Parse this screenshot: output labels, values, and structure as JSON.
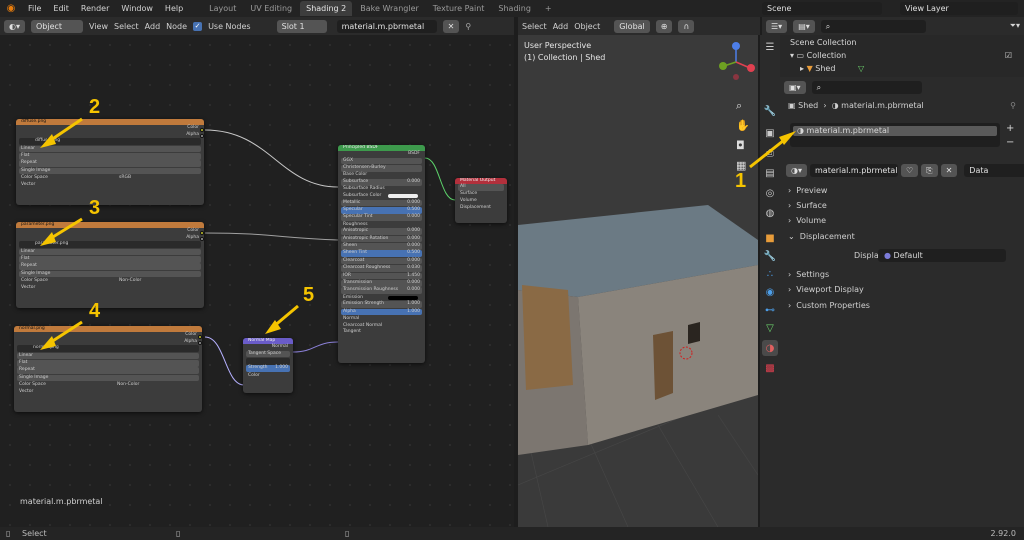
{
  "menu": [
    "File",
    "Edit",
    "Render",
    "Window",
    "Help"
  ],
  "workspaces": [
    "Layout",
    "UV Editing",
    "Shading 2",
    "Bake Wrangler",
    "Texture Paint",
    "Shading"
  ],
  "active_ws": "Shading 2",
  "scene": "Scene",
  "view_layer": "View Layer",
  "node_header": {
    "mode": "Object",
    "menus": [
      "View",
      "Select",
      "Add",
      "Node"
    ],
    "use_nodes": "Use Nodes",
    "slot": "Slot 1",
    "material": "material.m.pbrmetal"
  },
  "vp_header": {
    "menus": [
      "Select",
      "Add",
      "Object"
    ],
    "orient": "Global"
  },
  "viewport": {
    "title": "User Perspective",
    "subtitle": "(1) Collection | Shed"
  },
  "outliner": {
    "root": "Scene Collection",
    "collection": "Collection",
    "object": "Shed"
  },
  "props": {
    "crumb_obj": "Shed",
    "crumb_mat": "material.m.pbrmetal",
    "slot_item": "material.m.pbrmetal",
    "mat_field": "material.m.pbrmetal",
    "link": "Data",
    "panels": [
      "Preview",
      "Surface",
      "Volume",
      "Displacement"
    ],
    "disp_label": "Displacement",
    "disp_value": "Default",
    "panels2": [
      "Settings",
      "Viewport Display",
      "Custom Properties"
    ]
  },
  "node_label": "material.m.pbrmetal",
  "nodes": {
    "diffuse": {
      "title": "diffuse.png",
      "file": "diffuse.png",
      "rows": [
        "Linear",
        "Flat",
        "Repeat",
        "Single Image"
      ],
      "cs": "Color Space",
      "csv": "sRGB",
      "out1": "Color",
      "out2": "Alpha",
      "vec": "Vector"
    },
    "param": {
      "title": "parameter.png",
      "file": "parameter.png",
      "rows": [
        "Linear",
        "Flat",
        "Repeat",
        "Single Image"
      ],
      "cs": "Color Space",
      "csv": "Non-Color",
      "out1": "Color",
      "out2": "Alpha",
      "vec": "Vector"
    },
    "normal": {
      "title": "normal.png",
      "file": "normal.png",
      "rows": [
        "Linear",
        "Flat",
        "Repeat",
        "Single Image"
      ],
      "cs": "Color Space",
      "csv": "Non-Color",
      "out1": "Color",
      "out2": "Alpha",
      "vec": "Vector"
    },
    "nmap": {
      "title": "Normal Map",
      "out": "Normal",
      "space_label": "Tangent Space",
      "strength": "Strength",
      "strength_v": "1.000",
      "col": "Color"
    },
    "bsdf": {
      "title": "Principled BSDF",
      "out": "BSDF",
      "dist": "GGX",
      "sss": "Christensen-Burley",
      "rows": [
        [
          "Base Color",
          ""
        ],
        [
          "Subsurface",
          "0.000"
        ],
        [
          "Subsurface Radius",
          ""
        ],
        [
          "Subsurface Color",
          ""
        ],
        [
          "Metallic",
          "0.000"
        ],
        [
          "Specular",
          "0.500"
        ],
        [
          "Specular Tint",
          "0.000"
        ],
        [
          "Roughness",
          ""
        ],
        [
          "Anisotropic",
          "0.000"
        ],
        [
          "Anisotropic Rotation",
          "0.000"
        ],
        [
          "Sheen",
          "0.000"
        ],
        [
          "Sheen Tint",
          "0.500"
        ],
        [
          "Clearcoat",
          "0.000"
        ],
        [
          "Clearcoat Roughness",
          "0.030"
        ],
        [
          "IOR",
          "1.450"
        ],
        [
          "Transmission",
          "0.000"
        ],
        [
          "Transmission Roughness",
          "0.000"
        ],
        [
          "Emission",
          ""
        ],
        [
          "Emission Strength",
          "1.000"
        ],
        [
          "Alpha",
          "1.000"
        ],
        [
          "Normal",
          ""
        ],
        [
          "Clearcoat Normal",
          ""
        ],
        [
          "Tangent",
          ""
        ]
      ]
    },
    "out": {
      "title": "Material Output",
      "target": "All",
      "rows": [
        "Surface",
        "Volume",
        "Displacement"
      ]
    }
  },
  "arrows": [
    "1",
    "2",
    "3",
    "4",
    "5"
  ],
  "status": {
    "select": "Select",
    "version": "2.92.0"
  }
}
